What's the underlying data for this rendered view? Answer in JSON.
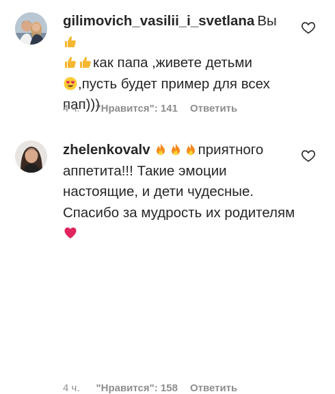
{
  "comments": [
    {
      "username": "gilimovich_vasilii_i_svetlana",
      "text_1": "Вы",
      "text_2": "как папа ,живете детьми",
      "text_3": ",пусть будет пример для всех пап)))",
      "emojis": [
        "thumbs-up",
        "thumbs-up",
        "thumbs-up",
        "heart-eyes"
      ],
      "time": "4 ч.",
      "likes": "\"Нравится\": 141",
      "reply": "Ответить"
    },
    {
      "username": "zhelenkovalv",
      "text_1": "приятного аппетита!!! Такие эмоции настоящие, и дети чудесные. Спасибо за мудрость их родителям",
      "emojis": [
        "fire",
        "fire",
        "fire",
        "red-heart"
      ],
      "time": "4 ч.",
      "likes": "\"Нравится\": 158",
      "reply": "Ответить"
    }
  ],
  "colors": {
    "text": "#262626",
    "meta": "#8e8e8e",
    "thumb": "#f7b731",
    "fire": "#f58a1f",
    "heart": "#e0245e"
  }
}
